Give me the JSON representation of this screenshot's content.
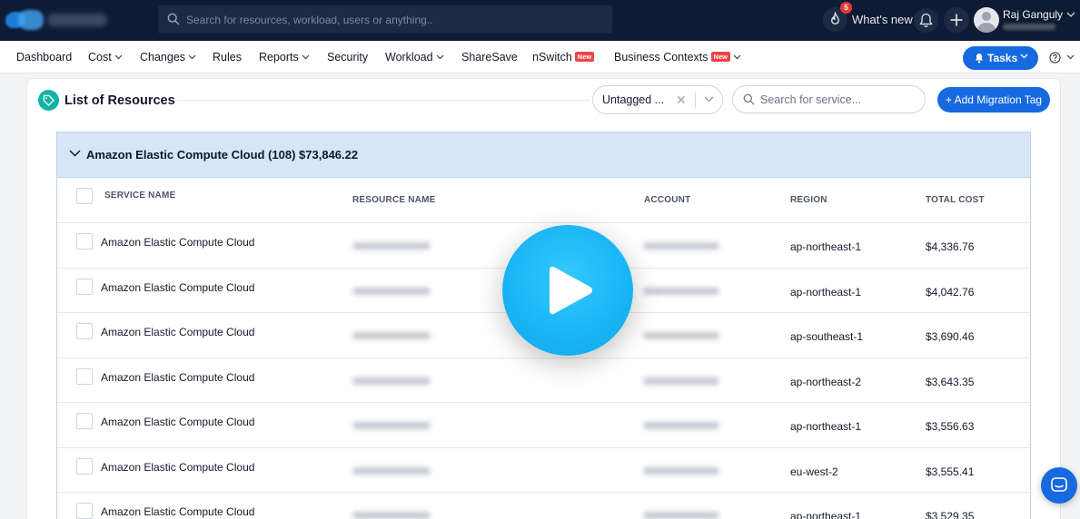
{
  "topbar": {
    "search_placeholder": "Search for resources, workload, users or anything..",
    "notification_count": "5",
    "whats_new": "What's new",
    "user_name": "Raj Ganguly"
  },
  "nav": {
    "items": [
      {
        "label": "Dashboard"
      },
      {
        "label": "Cost"
      },
      {
        "label": "Changes"
      },
      {
        "label": "Rules"
      },
      {
        "label": "Reports"
      },
      {
        "label": "Security"
      },
      {
        "label": "Workload"
      },
      {
        "label": "ShareSave"
      },
      {
        "label": "nSwitch"
      },
      {
        "label": "Business Contexts"
      }
    ],
    "new_badge": "New",
    "tasks": "Tasks"
  },
  "main": {
    "title": "List of Resources",
    "filter_value": "Untagged ...",
    "service_search_placeholder": "Search for service...",
    "add_tag_button": "+ Add Migration Tag",
    "group_title": "Amazon Elastic Compute Cloud (108) $73,846.22",
    "columns": [
      "SERVICE NAME",
      "RESOURCE NAME",
      "ACCOUNT",
      "REGION",
      "TOTAL COST"
    ],
    "rows": [
      {
        "service": "Amazon Elastic Compute Cloud",
        "region": "ap-northeast-1",
        "cost": "$4,336.76"
      },
      {
        "service": "Amazon Elastic Compute Cloud",
        "region": "ap-northeast-1",
        "cost": "$4,042.76"
      },
      {
        "service": "Amazon Elastic Compute Cloud",
        "region": "ap-southeast-1",
        "cost": "$3,690.46"
      },
      {
        "service": "Amazon Elastic Compute Cloud",
        "region": "ap-northeast-2",
        "cost": "$3,643.35"
      },
      {
        "service": "Amazon Elastic Compute Cloud",
        "region": "ap-northeast-1",
        "cost": "$3,556.63"
      },
      {
        "service": "Amazon Elastic Compute Cloud",
        "region": "eu-west-2",
        "cost": "$3,555.41"
      },
      {
        "service": "Amazon Elastic Compute Cloud",
        "region": "ap-northeast-1",
        "cost": "$3,529.35"
      }
    ]
  },
  "colors": {
    "topbar_bg": "#0f1b34",
    "primary": "#1769e0",
    "group_header_bg": "#d7e5f8",
    "play_button": "#19b4f5",
    "tag_icon": "#12b3a5"
  },
  "icons": [
    "search-icon",
    "flame-icon",
    "bell-icon",
    "plus-icon",
    "avatar",
    "chevron-down-icon",
    "bell-icon",
    "help-icon",
    "tag-icon",
    "close-icon",
    "play-icon",
    "chat-icon"
  ]
}
